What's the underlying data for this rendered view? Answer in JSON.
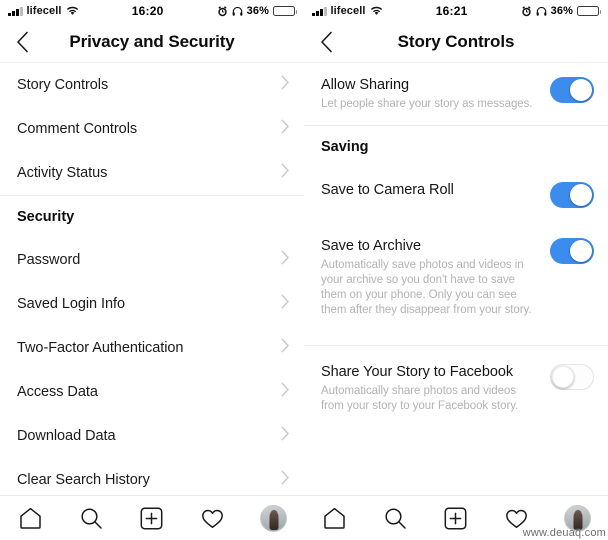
{
  "screens": [
    {
      "id": "privacy-and-security",
      "status_bar": {
        "carrier": "lifecell",
        "signal_icon": "signal-bars-icon",
        "wifi_icon": "wifi-icon",
        "time": "16:20",
        "alarm_icon": "alarm-clock-icon",
        "headphones_icon": "headphones-icon",
        "battery_percent": "36%",
        "battery_icon": "battery-icon",
        "battery_level": 36
      },
      "nav": {
        "back_icon": "chevron-left-icon",
        "title": "Privacy and Security"
      },
      "rows": [
        {
          "type": "link",
          "label": "Story Controls",
          "chevron": "chevron-right-icon"
        },
        {
          "type": "link",
          "label": "Comment Controls",
          "chevron": "chevron-right-icon"
        },
        {
          "type": "link",
          "label": "Activity Status",
          "chevron": "chevron-right-icon"
        },
        {
          "type": "divider"
        },
        {
          "type": "header",
          "label": "Security"
        },
        {
          "type": "link",
          "label": "Password",
          "chevron": "chevron-right-icon"
        },
        {
          "type": "link",
          "label": "Saved Login Info",
          "chevron": "chevron-right-icon"
        },
        {
          "type": "link",
          "label": "Two-Factor Authentication",
          "chevron": "chevron-right-icon"
        },
        {
          "type": "link",
          "label": "Access Data",
          "chevron": "chevron-right-icon"
        },
        {
          "type": "link",
          "label": "Download Data",
          "chevron": "chevron-right-icon"
        },
        {
          "type": "link",
          "label": "Clear Search History",
          "chevron": "chevron-right-icon"
        }
      ],
      "tabbar": [
        {
          "icon": "home-icon",
          "label": "Home"
        },
        {
          "icon": "search-icon",
          "label": "Search"
        },
        {
          "icon": "add-post-icon",
          "label": "New Post"
        },
        {
          "icon": "heart-icon",
          "label": "Activity"
        },
        {
          "icon": "profile-avatar-icon",
          "label": "Profile"
        }
      ],
      "watermark": ""
    },
    {
      "id": "story-controls",
      "status_bar": {
        "carrier": "lifecell",
        "signal_icon": "signal-bars-icon",
        "wifi_icon": "wifi-icon",
        "time": "16:21",
        "alarm_icon": "alarm-clock-icon",
        "headphones_icon": "headphones-icon",
        "battery_percent": "36%",
        "battery_icon": "battery-icon",
        "battery_level": 36
      },
      "nav": {
        "back_icon": "chevron-left-icon",
        "title": "Story Controls"
      },
      "cells": [
        {
          "type": "toggle",
          "name": "allow-sharing",
          "title": "Allow Sharing",
          "subtitle": "Let people share your story as messages.",
          "state": "on"
        },
        {
          "type": "divider"
        },
        {
          "type": "header",
          "label": "Saving"
        },
        {
          "type": "toggle",
          "name": "save-to-camera-roll",
          "title": "Save to Camera Roll",
          "subtitle": "",
          "state": "on"
        },
        {
          "type": "toggle",
          "name": "save-to-archive",
          "title": "Save to Archive",
          "subtitle": "Automatically save photos and videos in your archive so you don't have to save them on your phone. Only you can see them after they disappear from your story.",
          "state": "on"
        },
        {
          "type": "divider"
        },
        {
          "type": "toggle",
          "name": "share-your-story-to-facebook",
          "title": "Share Your Story to Facebook",
          "subtitle": "Automatically share photos and videos from your story to your Facebook story.",
          "state": "off"
        }
      ],
      "tabbar": [
        {
          "icon": "home-icon",
          "label": "Home"
        },
        {
          "icon": "search-icon",
          "label": "Search"
        },
        {
          "icon": "add-post-icon",
          "label": "New Post"
        },
        {
          "icon": "heart-icon",
          "label": "Activity"
        },
        {
          "icon": "profile-avatar-icon",
          "label": "Profile"
        }
      ],
      "watermark": "www.deuaq.com"
    }
  ],
  "colors": {
    "toggle_on": "#3b8ced",
    "toggle_off_border": "#e4e4e4",
    "text_primary": "#151515",
    "text_secondary": "#b3b3b3",
    "divider": "#efefef"
  }
}
